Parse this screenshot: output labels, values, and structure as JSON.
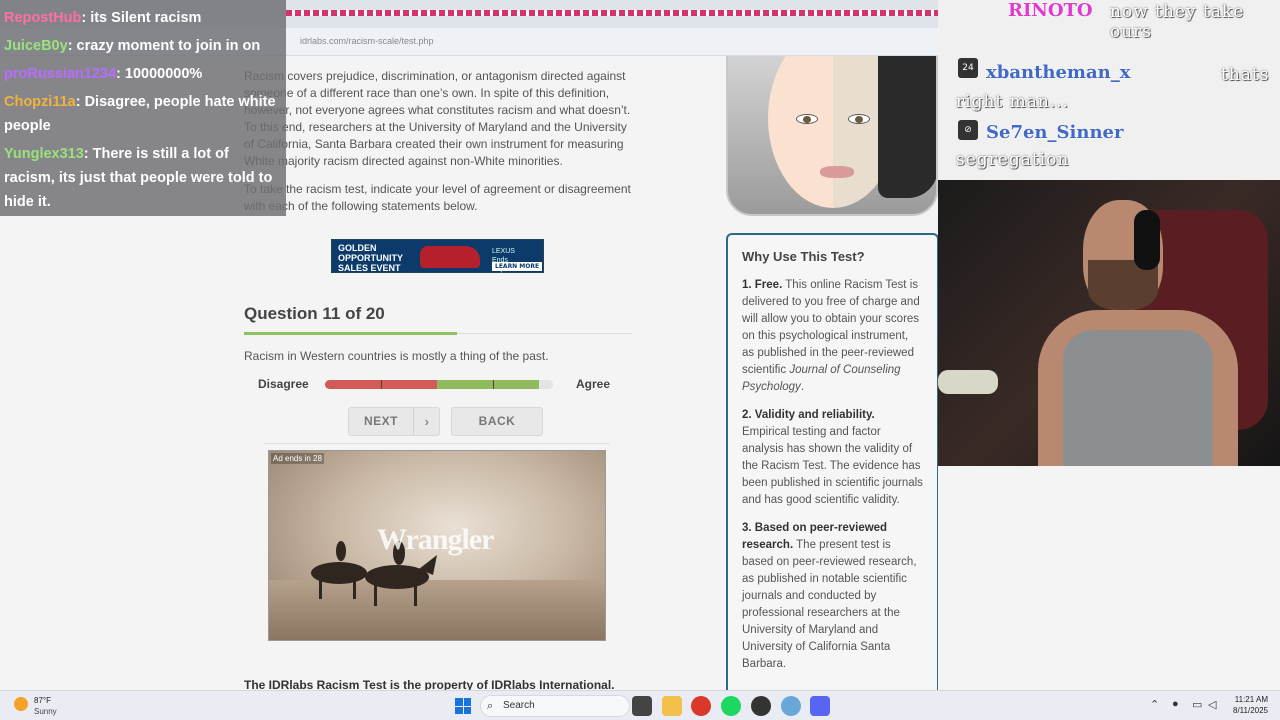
{
  "browser": {
    "url": "idrlabs.com/racism-scale/test.php",
    "window_minimize": "–",
    "window_maximize": "▢",
    "window_close": "✕"
  },
  "page": {
    "intro_p1": "Racism covers prejudice, discrimination, or antagonism directed against someone of a different race than one’s own. In spite of this definition, however, not everyone agrees what constitutes racism and what doesn’t. To this end, researchers at the University of Maryland and the University of California, Santa Barbara created their own instrument for measuring White majority racism directed against non-White minorities.",
    "intro_p2": "To take the racism test, indicate your level of agreement or disagreement with each of the following statements below.",
    "banner_ad": {
      "headline": "GOLDEN OPPORTUNITY SALES EVENT",
      "brand": "LEXUS",
      "offer": "Ends September 2",
      "cta": "LEARN MORE"
    },
    "question_title": "Question 11 of 20",
    "question_progress": 0.55,
    "question_text": "Racism in Western countries is mostly a thing of the past.",
    "scale_left": "Disagree",
    "scale_right": "Agree",
    "next_label": "NEXT",
    "next_chevron": "›",
    "back_label": "BACK",
    "video_ad": {
      "countdown": "Ad ends in 28",
      "brand": "Wrangler"
    },
    "footer": "The IDRlabs Racism Test is the property of IDRlabs International."
  },
  "why_box": {
    "title": "Why Use This Test?",
    "items": [
      {
        "head": "1. Free.",
        "body": "This online Racism Test is delivered to you free of charge and will allow you to obtain your scores on this psychological instrument, as published in the peer-reviewed scientific",
        "italic": "Journal of Counseling Psychology",
        "tail": "."
      },
      {
        "head": "2. Validity and reliability.",
        "body": "Empirical testing and factor analysis has shown the validity of the Racism Test. The evidence has been published in scientific journals and has good scientific validity."
      },
      {
        "head": "3. Based on peer-reviewed research.",
        "body": "The present test is based on peer-reviewed research, as published in notable scientific journals and conducted by professional researchers at the University of Maryland and University of California Santa Barbara."
      }
    ]
  },
  "chat_overlay": [
    {
      "user": "RepostHub",
      "text": ": its Silent racism",
      "color": "#ff6fa1"
    },
    {
      "user": "JuiceB0y",
      "text": ": crazy moment to join in on",
      "color": "#9be27a"
    },
    {
      "user": "proRussian1234",
      "text": ": 10000000%",
      "color": "#b86cff"
    },
    {
      "user": "Chopzi11a",
      "text": ": Disagree, people hate white people",
      "color": "#f0b43c"
    },
    {
      "user": "Yunglex313",
      "text": ": There is still a lot of racism, its just that people were told to hide it.",
      "color": "#9be27a"
    }
  ],
  "stream_chat": {
    "top_user": "RINOTO",
    "top_text": "now they take ours",
    "line2_user": "xbantheman_x",
    "line2_text": "thats right man...",
    "line2_badge": "24",
    "line3_user": "Se7en_Sinner",
    "line3_text": "segregation"
  },
  "taskbar": {
    "temp": "87°F",
    "condition": "Sunny",
    "weather_badge": "2",
    "search_label": "Search",
    "time": "11:21 AM",
    "date": "8/11/2025"
  }
}
